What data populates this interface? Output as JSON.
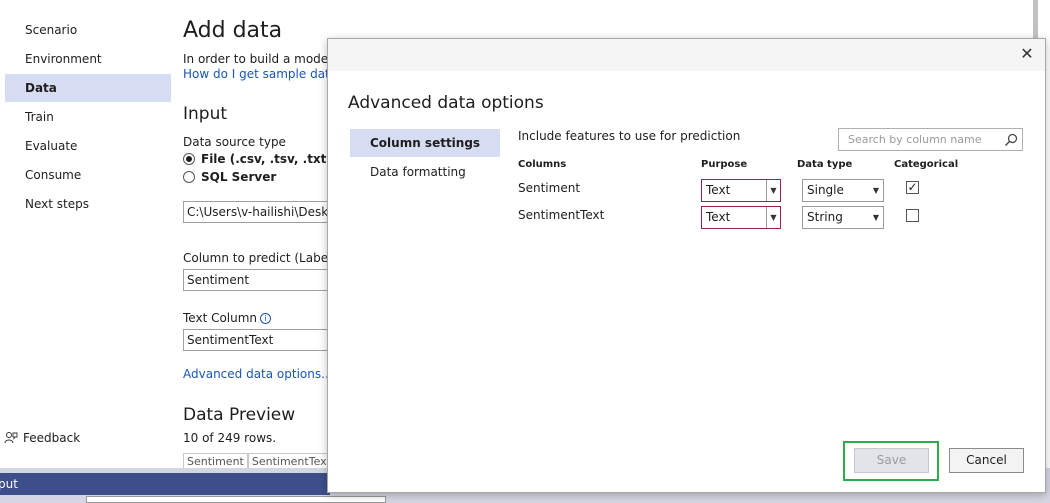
{
  "nav": {
    "items": [
      {
        "label": "Scenario",
        "active": false
      },
      {
        "label": "Environment",
        "active": false
      },
      {
        "label": "Data",
        "active": true
      },
      {
        "label": "Train",
        "active": false
      },
      {
        "label": "Evaluate",
        "active": false
      },
      {
        "label": "Consume",
        "active": false
      },
      {
        "label": "Next steps",
        "active": false
      }
    ],
    "feedback_label": "Feedback"
  },
  "main": {
    "title": "Add data",
    "intro_text": "In order to build a model, y",
    "intro_link": "How do I get sample datase",
    "input_section": "Input",
    "data_source_label": "Data source type",
    "source_options": [
      {
        "label": "File (.csv, .tsv, .txt)",
        "selected": true
      },
      {
        "label": "SQL Server",
        "selected": false
      }
    ],
    "file_path": "C:\\Users\\v-hailishi\\Desktop",
    "label_column_label": "Column to predict (Label):",
    "label_column_value": "Sentiment",
    "text_column_label": "Text Column",
    "text_column_value": "SentimentText",
    "advanced_link": "Advanced data options...",
    "preview_section": "Data Preview",
    "rows_text": "10 of 249 rows.",
    "preview_headers": [
      "Sentiment",
      "SentimentText"
    ]
  },
  "bottom": {
    "output_label": "put"
  },
  "modal": {
    "close_glyph": "✕",
    "title": "Advanced data options",
    "tabs": [
      {
        "label": "Column settings",
        "active": true
      },
      {
        "label": "Data formatting",
        "active": false
      }
    ],
    "include_label": "Include features to use for prediction",
    "search_placeholder": "Search by column name",
    "columns_header": "Columns",
    "purpose_header": "Purpose",
    "datatype_header": "Data type",
    "categorical_header": "Categorical",
    "rows": [
      {
        "column": "Sentiment",
        "purpose": "Text",
        "data_type": "Single",
        "categorical": true
      },
      {
        "column": "SentimentText",
        "purpose": "Text",
        "data_type": "String",
        "categorical": false
      }
    ],
    "save_label": "Save",
    "cancel_label": "Cancel"
  },
  "colors": {
    "active_bg": "#d6dcf1",
    "link": "#1a56b8",
    "purpose_border": "#9b2242",
    "save_highlight": "#2eab4a",
    "output_bar": "#3d4f8b"
  }
}
